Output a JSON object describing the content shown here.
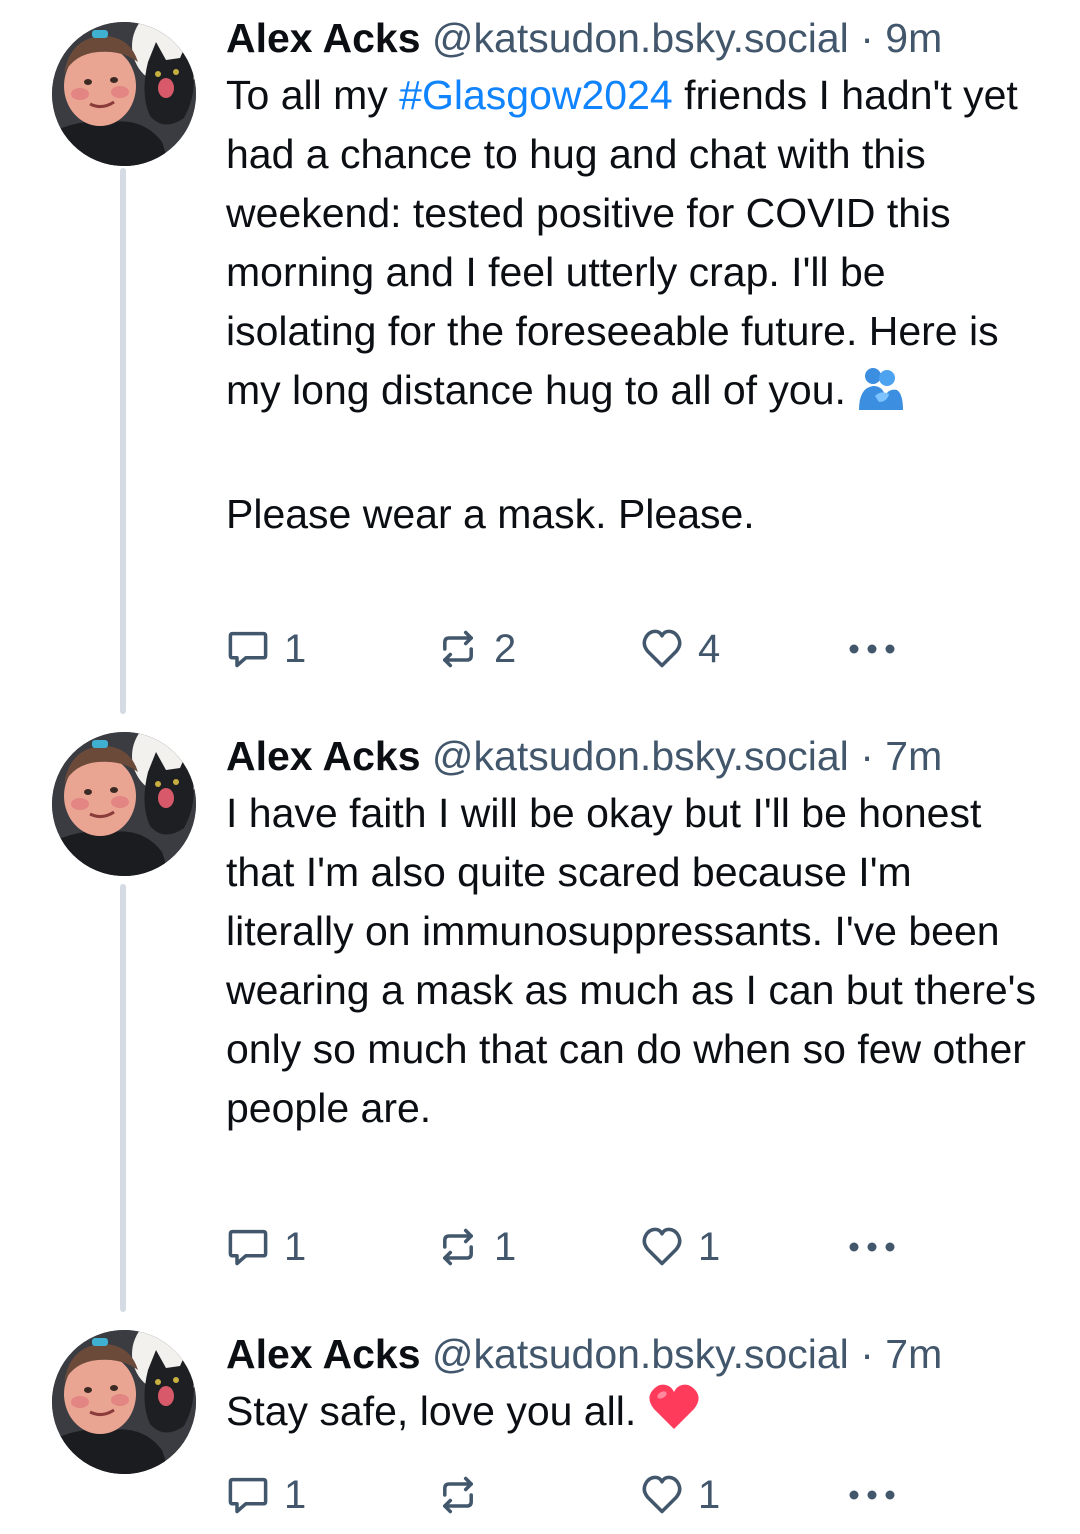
{
  "posts": [
    {
      "author": "Alex Acks",
      "handle": "@katsudon.bsky.social",
      "separator": "·",
      "time": "9m",
      "text_before_tag": "To all my ",
      "hashtag": "#Glasgow2024",
      "text_after_tag": " friends I hadn't yet had a chance to hug and chat with this weekend: tested positive for COVID this morning and I feel utterly crap. I'll be isolating for the foreseeable future. Here is my long distance hug to all of you.",
      "emoji": "people-hugging-emoji",
      "text_second_paragraph": "Please wear a mask. Please.",
      "replies": "1",
      "reposts": "2",
      "likes": "4"
    },
    {
      "author": "Alex Acks",
      "handle": "@katsudon.bsky.social",
      "separator": "·",
      "time": "7m",
      "text": "I have faith I will be okay but I'll be honest that I'm also quite scared because I'm literally on immunosuppressants. I've been wearing a mask as much as I can but there's only so much that can do when so few other people are.",
      "replies": "1",
      "reposts": "1",
      "likes": "1"
    },
    {
      "author": "Alex Acks",
      "handle": "@katsudon.bsky.social",
      "separator": "·",
      "time": "7m",
      "text": "Stay safe, love you all.",
      "emoji": "red-heart-emoji",
      "replies": "1",
      "reposts": "",
      "likes": "1"
    }
  ],
  "colors": {
    "hashtag": "#1083fe",
    "secondary_text": "#42576c",
    "thread_line": "#d4dbe2",
    "heart": "#ff3b5c"
  }
}
